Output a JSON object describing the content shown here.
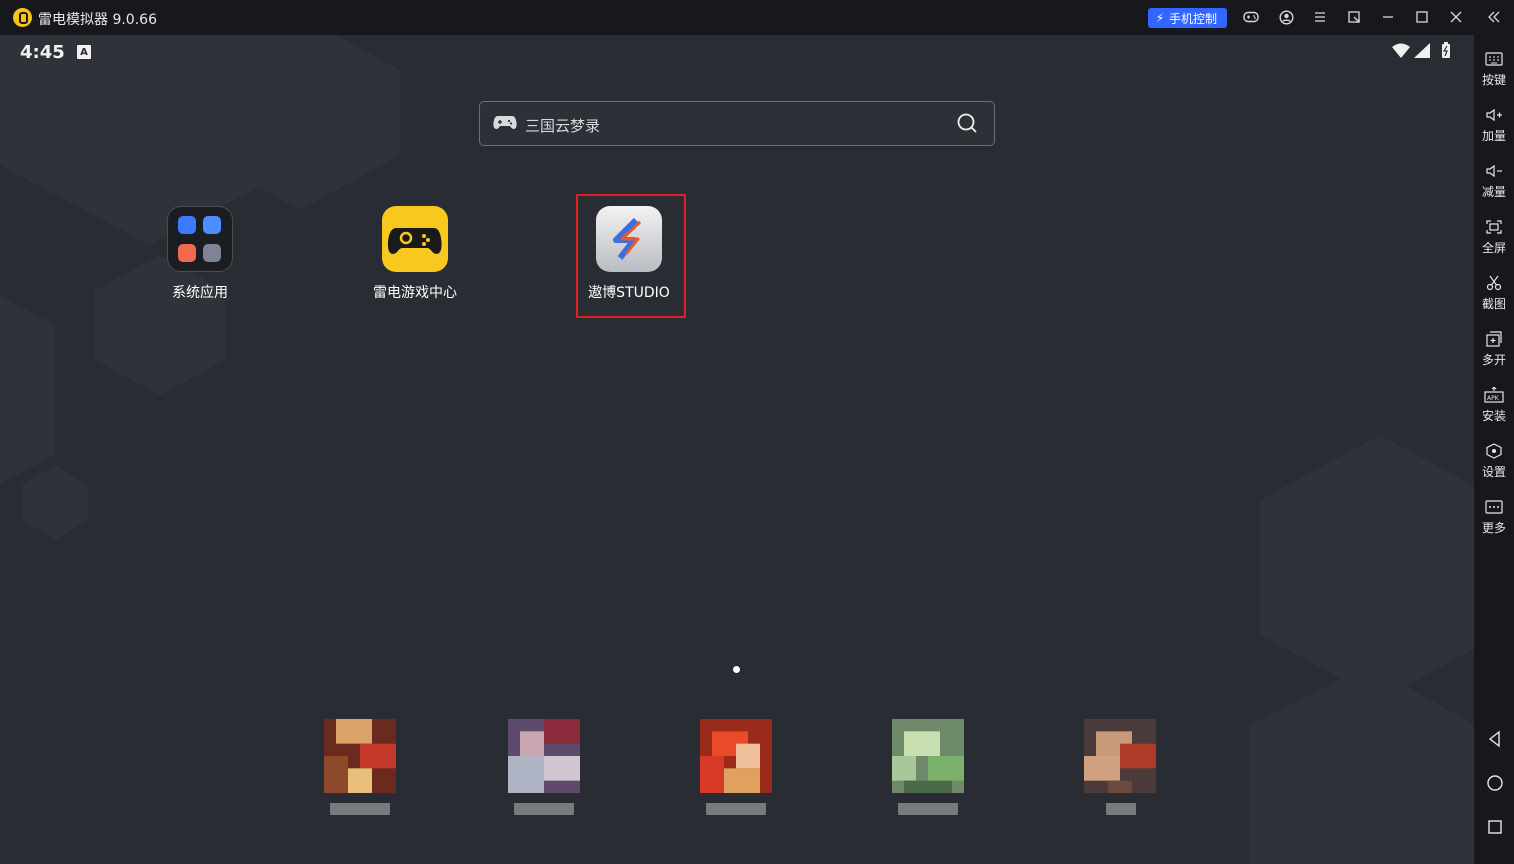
{
  "window": {
    "title": "雷电模拟器 9.0.66",
    "phone_control_label": "手机控制",
    "controls": [
      "gamepad-icon",
      "account-icon",
      "menu-icon",
      "popout-icon",
      "minimize-icon",
      "maximize-icon",
      "close-icon",
      "collapse-icon"
    ]
  },
  "statusbar": {
    "time": "4:45",
    "badge": "A"
  },
  "search": {
    "placeholder": "三国云梦录"
  },
  "apps": [
    {
      "label": "系统应用",
      "icon": "system-apps-folder-icon"
    },
    {
      "label": "雷电游戏中心",
      "icon": "game-center-icon"
    },
    {
      "label": "遨博STUDIO",
      "icon": "studio-icon"
    }
  ],
  "sidebar": {
    "items": [
      {
        "label": "按键",
        "icon": "keyboard-icon"
      },
      {
        "label": "加量",
        "icon": "volume-up-icon"
      },
      {
        "label": "减量",
        "icon": "volume-down-icon"
      },
      {
        "label": "全屏",
        "icon": "fullscreen-icon"
      },
      {
        "label": "截图",
        "icon": "scissors-icon"
      },
      {
        "label": "多开",
        "icon": "multi-instance-icon"
      },
      {
        "label": "安装",
        "icon": "apk-install-icon"
      },
      {
        "label": "设置",
        "icon": "settings-icon"
      },
      {
        "label": "更多",
        "icon": "more-icon"
      }
    ],
    "nav": [
      "back-icon",
      "home-icon",
      "recents-icon"
    ]
  },
  "colors": {
    "accent": "#3366ff",
    "highlight": "#e02020",
    "game_center": "#f7c81e"
  }
}
